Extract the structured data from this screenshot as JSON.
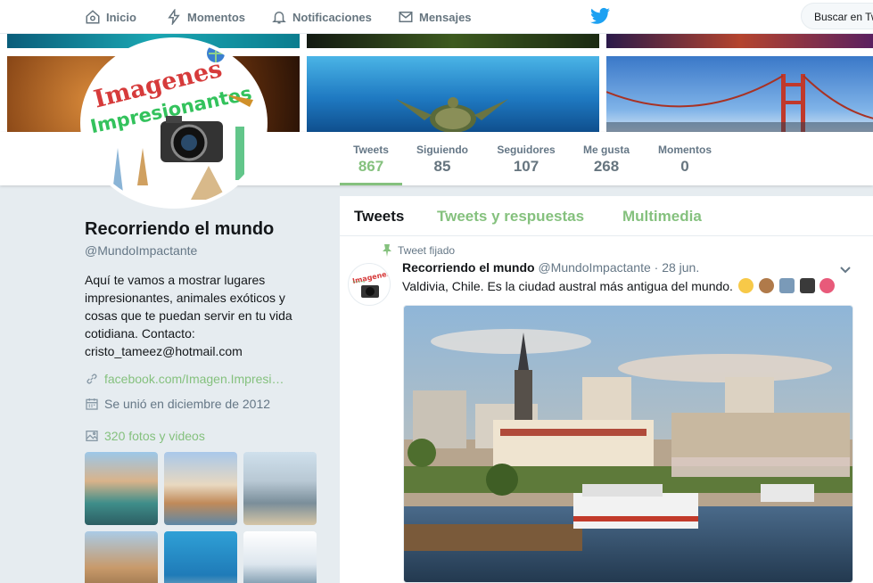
{
  "nav": {
    "items": [
      {
        "label": "Inicio",
        "icon": "home-icon"
      },
      {
        "label": "Momentos",
        "icon": "lightning-icon"
      },
      {
        "label": "Notificaciones",
        "icon": "bell-icon"
      },
      {
        "label": "Mensajes",
        "icon": "envelope-icon"
      }
    ],
    "search_placeholder": "Buscar en Tw"
  },
  "colors": {
    "accent": "#85c17e",
    "twitter_blue": "#1da1f2",
    "muted": "#657786"
  },
  "avatar": {
    "line1": "Imagenes",
    "line2": "Impresionantes"
  },
  "stats": [
    {
      "label": "Tweets",
      "value": "867"
    },
    {
      "label": "Siguiendo",
      "value": "85"
    },
    {
      "label": "Seguidores",
      "value": "107"
    },
    {
      "label": "Me gusta",
      "value": "268"
    },
    {
      "label": "Momentos",
      "value": "0"
    }
  ],
  "profile": {
    "name": "Recorriendo el mundo",
    "handle": "@MundoImpactante",
    "bio_lines": [
      "Aquí te vamos a mostrar lugares",
      "impresionantes, animales exóticos y",
      "cosas que te puedan servir en tu vida",
      "cotidiana. Contacto:",
      "cristo_tameez@hotmail.com"
    ],
    "website": "facebook.com/Imagen.Impresi…",
    "joined": "Se unió en diciembre de 2012",
    "photos_label": "320 fotos y videos"
  },
  "timeline": {
    "tabs": [
      "Tweets",
      "Tweets y respuestas",
      "Multimedia"
    ],
    "pinned_label": "Tweet fijado",
    "tweet": {
      "name": "Recorriendo el mundo",
      "handle": "@MundoImpactante",
      "date": "· 28 jun.",
      "text": "Valdivia, Chile. Es la ciudad austral más antigua del mundo."
    }
  }
}
